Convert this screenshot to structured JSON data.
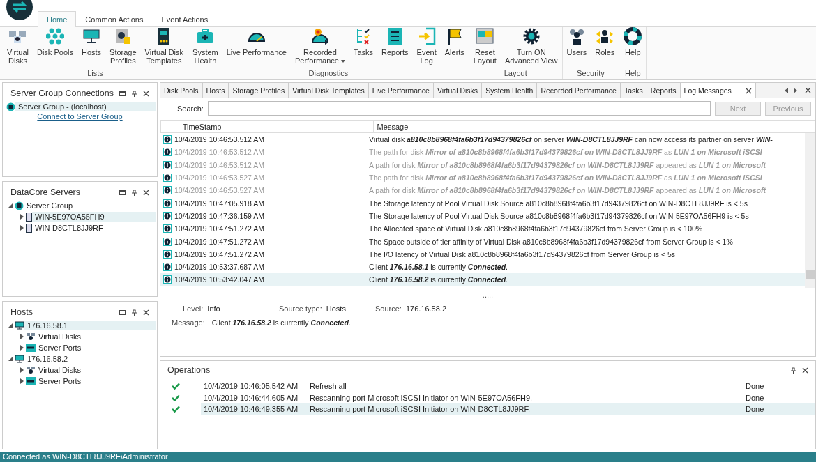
{
  "ribbon": {
    "tabs": [
      {
        "label": "Home",
        "selected": true
      },
      {
        "label": "Common Actions",
        "selected": false
      },
      {
        "label": "Event Actions",
        "selected": false
      }
    ],
    "groups": [
      {
        "label": "Lists",
        "buttons": [
          {
            "label": "Virtual\nDisks"
          },
          {
            "label": "Disk Pools"
          },
          {
            "label": "Hosts"
          },
          {
            "label": "Storage\nProfiles"
          },
          {
            "label": "Virtual Disk\nTemplates"
          }
        ]
      },
      {
        "label": "Diagnostics",
        "buttons": [
          {
            "label": "System\nHealth"
          },
          {
            "label": "Live Performance"
          },
          {
            "label": "Recorded\nPerformance",
            "dropdown": true
          },
          {
            "label": "Tasks"
          },
          {
            "label": "Reports"
          },
          {
            "label": "Event\nLog"
          },
          {
            "label": "Alerts"
          }
        ]
      },
      {
        "label": "Layout",
        "buttons": [
          {
            "label": "Reset\nLayout"
          },
          {
            "label": "Turn ON\nAdvanced View"
          }
        ]
      },
      {
        "label": "Security",
        "buttons": [
          {
            "label": "Users"
          },
          {
            "label": "Roles"
          }
        ]
      },
      {
        "label": "Help",
        "buttons": [
          {
            "label": "Help"
          }
        ]
      }
    ]
  },
  "panels": [
    {
      "title": "Server Group Connections",
      "items": [
        {
          "label": "Server Group - (localhost)",
          "selected": true
        }
      ],
      "link": "Connect to Server Group"
    },
    {
      "title": "DataCore Servers",
      "items": [
        {
          "label": "Server Group",
          "selected": false,
          "expanded": true,
          "children": [
            {
              "label": "WIN-5E97OA56FH9",
              "selected": true,
              "expanded": false
            },
            {
              "label": "WIN-D8CTL8JJ9RF",
              "selected": false,
              "expanded": false
            }
          ]
        }
      ]
    },
    {
      "title": "Hosts",
      "items": [
        {
          "label": "176.16.58.1",
          "selected": true,
          "expanded": true,
          "children": [
            {
              "label": "Virtual Disks",
              "selected": false,
              "expanded": false
            },
            {
              "label": "Server Ports",
              "selected": false,
              "expanded": false
            }
          ]
        },
        {
          "label": "176.16.58.2",
          "selected": false,
          "expanded": true,
          "children": [
            {
              "label": "Virtual Disks",
              "selected": false,
              "expanded": false
            },
            {
              "label": "Server Ports",
              "selected": false,
              "expanded": false
            }
          ]
        }
      ]
    }
  ],
  "doc_tabs": [
    {
      "label": "Disk Pools",
      "selected": false
    },
    {
      "label": "Hosts",
      "selected": false
    },
    {
      "label": "Storage Profiles",
      "selected": false
    },
    {
      "label": "Virtual Disk Templates",
      "selected": false
    },
    {
      "label": "Live Performance",
      "selected": false
    },
    {
      "label": "Virtual Disks",
      "selected": false
    },
    {
      "label": "System Health",
      "selected": false
    },
    {
      "label": "Recorded Performance",
      "selected": false
    },
    {
      "label": "Tasks",
      "selected": false
    },
    {
      "label": "Reports",
      "selected": false
    },
    {
      "label": "Log Messages",
      "selected": true
    }
  ],
  "search": {
    "label": "Search:",
    "next": "Next",
    "previous": "Previous"
  },
  "log": {
    "columns": [
      "TimeStamp",
      "Message"
    ],
    "rows": [
      {
        "time": "10/4/2019 10:46:53.512 AM",
        "message": "Virtual disk **a810c8b8968f4fa6b3f17d94379826cf** on server **WIN-D8CTL8JJ9RF** can now access its partner on server **WIN-**",
        "dimmed": false,
        "selected": false
      },
      {
        "time": "10/4/2019 10:46:53.512 AM",
        "message": "The path for disk **Mirror of a810c8b8968f4fa6b3f17d94379826cf on WIN-D8CTL8JJ9RF** as **LUN 1 on Microsoft iSCSI**",
        "dimmed": true,
        "selected": false
      },
      {
        "time": "10/4/2019 10:46:53.512 AM",
        "message": "A path for disk **Mirror of a810c8b8968f4fa6b3f17d94379826cf on WIN-D8CTL8JJ9RF** appeared as **LUN 1 on Microsoft**",
        "dimmed": true,
        "selected": false
      },
      {
        "time": "10/4/2019 10:46:53.527 AM",
        "message": "The path for disk **Mirror of a810c8b8968f4fa6b3f17d94379826cf on WIN-D8CTL8JJ9RF** as **LUN 1 on Microsoft iSCSI**",
        "dimmed": true,
        "selected": false
      },
      {
        "time": "10/4/2019 10:46:53.527 AM",
        "message": "A path for disk **Mirror of a810c8b8968f4fa6b3f17d94379826cf on WIN-D8CTL8JJ9RF** appeared as **LUN 1 on Microsoft**",
        "dimmed": true,
        "selected": false
      },
      {
        "time": "10/4/2019 10:47:05.918 AM",
        "message": "The Storage latency of Pool Virtual Disk Source a810c8b8968f4fa6b3f17d94379826cf on WIN-D8CTL8JJ9RF is < 5s",
        "dimmed": false,
        "selected": false
      },
      {
        "time": "10/4/2019 10:47:36.159 AM",
        "message": "The Storage latency of Pool Virtual Disk Source a810c8b8968f4fa6b3f17d94379826cf on WIN-5E97OA56FH9 is < 5s",
        "dimmed": false,
        "selected": false
      },
      {
        "time": "10/4/2019 10:47:51.272 AM",
        "message": "The Allocated space of Virtual Disk a810c8b8968f4fa6b3f17d94379826cf from Server Group is < 100%",
        "dimmed": false,
        "selected": false
      },
      {
        "time": "10/4/2019 10:47:51.272 AM",
        "message": "The Space outside of tier affinity of Virtual Disk a810c8b8968f4fa6b3f17d94379826cf from Server Group is < 1%",
        "dimmed": false,
        "selected": false
      },
      {
        "time": "10/4/2019 10:47:51.272 AM",
        "message": "The I/O latency of Virtual Disk a810c8b8968f4fa6b3f17d94379826cf from Server Group is < 5s",
        "dimmed": false,
        "selected": false
      },
      {
        "time": "10/4/2019 10:53:37.687 AM",
        "message": "Client **176.16.58.1** is currently **Connected**.",
        "dimmed": false,
        "selected": false
      },
      {
        "time": "10/4/2019 10:53:42.047 AM",
        "message": "Client **176.16.58.2** is currently **Connected**.",
        "dimmed": false,
        "selected": true
      }
    ]
  },
  "details": {
    "splitter": ".....",
    "fields": [
      {
        "label": "Level:",
        "value": "Info"
      },
      {
        "label": "Source type:",
        "value": "Hosts"
      },
      {
        "label": "Source:",
        "value": "176.16.58.2"
      }
    ],
    "message_label": "Message:",
    "message": "Client **176.16.58.2** is currently **Connected**."
  },
  "operations": {
    "title": "Operations",
    "rows": [
      {
        "time": "10/4/2019 10:46:05.542 AM",
        "description": "Refresh all",
        "status": "Done",
        "selected": false
      },
      {
        "time": "10/4/2019 10:46:44.605 AM",
        "description": "Rescanning port Microsoft iSCSI Initiator on WIN-5E97OA56FH9.",
        "status": "Done",
        "selected": false
      },
      {
        "time": "10/4/2019 10:46:49.355 AM",
        "description": "Rescanning port Microsoft iSCSI Initiator on WIN-D8CTL8JJ9RF.",
        "status": "Done",
        "selected": true
      }
    ]
  },
  "status_bar": {
    "text": "Connected as WIN-D8CTL8JJ9RF\\Administrator"
  }
}
